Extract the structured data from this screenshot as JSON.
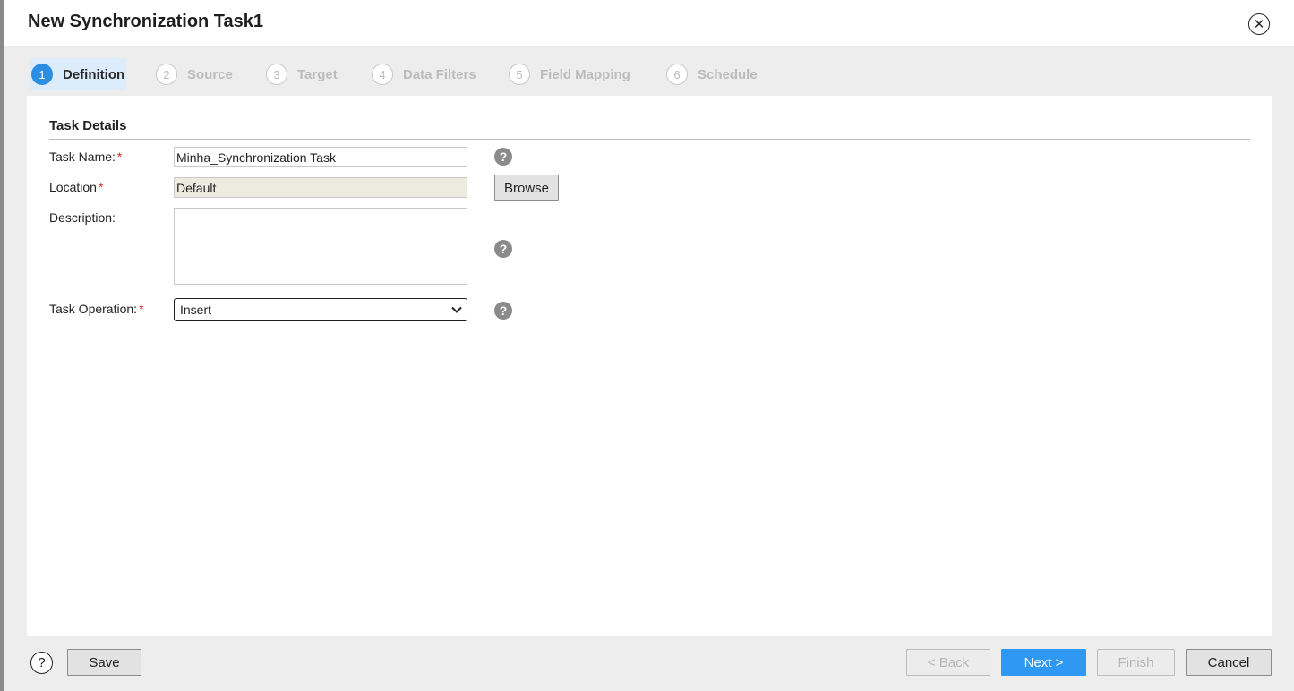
{
  "dialog": {
    "title": "New Synchronization Task1",
    "close_icon": "close-circle-icon"
  },
  "steps": [
    {
      "number": "1",
      "label": "Definition",
      "active": true
    },
    {
      "number": "2",
      "label": "Source",
      "active": false
    },
    {
      "number": "3",
      "label": "Target",
      "active": false
    },
    {
      "number": "4",
      "label": "Data Filters",
      "active": false
    },
    {
      "number": "5",
      "label": "Field Mapping",
      "active": false
    },
    {
      "number": "6",
      "label": "Schedule",
      "active": false
    }
  ],
  "form": {
    "section_title": "Task Details",
    "task_name": {
      "label": "Task Name:",
      "required_mark": "*",
      "value": "Minha_Synchronization Task"
    },
    "location": {
      "label": "Location",
      "required_mark": "*",
      "value": "Default",
      "browse_label": "Browse"
    },
    "description": {
      "label": "Description:",
      "value": ""
    },
    "task_operation": {
      "label": "Task Operation:",
      "required_mark": "*",
      "value": "Insert"
    },
    "help_glyph": "?"
  },
  "footer": {
    "help_glyph": "?",
    "save_label": "Save",
    "back_label": "< Back",
    "next_label": "Next >",
    "finish_label": "Finish",
    "cancel_label": "Cancel"
  },
  "colors": {
    "accent": "#2e98f2",
    "active_step_bg": "#dcecfb",
    "required": "#d12b2b"
  }
}
